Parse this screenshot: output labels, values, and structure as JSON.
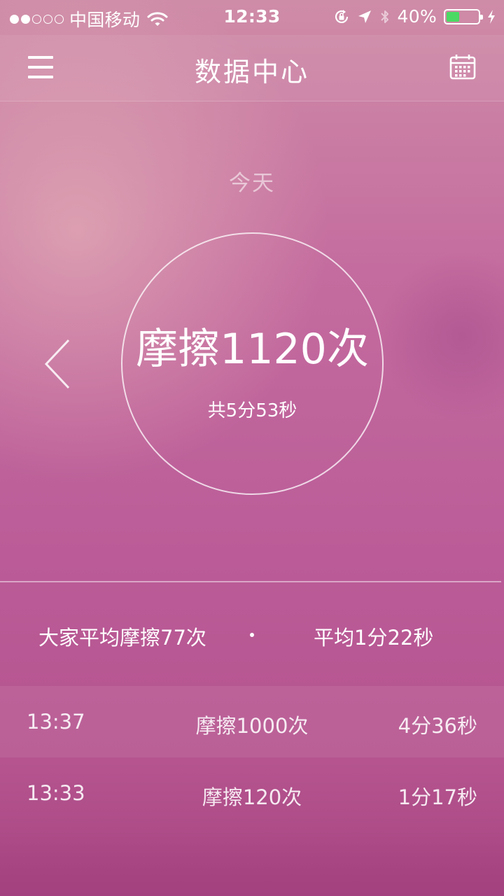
{
  "status_bar": {
    "signal": {
      "filled": 2,
      "total": 5
    },
    "carrier": "中国移动",
    "time": "12:33",
    "battery_percent": "40%",
    "battery_level": 0.4,
    "battery_color": "#4cd964"
  },
  "nav": {
    "title": "数据中心",
    "menu_icon": "menu-icon",
    "calendar_icon": "calendar-icon"
  },
  "summary": {
    "date_label": "今天",
    "count_text": "摩擦1120次",
    "total_time": "共5分53秒",
    "prev_icon": "chevron-left-icon"
  },
  "average": {
    "count_text": "大家平均摩擦77次",
    "time_text": "平均1分22秒"
  },
  "records": [
    {
      "time": "13:37",
      "count": "摩擦1000次",
      "duration": "4分36秒"
    },
    {
      "time": "13:33",
      "count": "摩擦120次",
      "duration": "1分17秒"
    }
  ],
  "colors": {
    "accent": "#ffffff",
    "background_top": "#cf8ca7",
    "background_bottom": "#a64581"
  }
}
